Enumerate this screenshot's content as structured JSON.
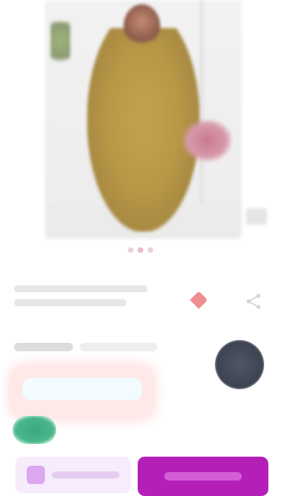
{
  "product": {
    "title": "",
    "price": "",
    "original_price": "",
    "promo_text": "",
    "badge": ""
  },
  "gallery": {
    "dots_total": 3,
    "active_dot": 1
  },
  "icons": {
    "wishlist": "heart-icon",
    "share": "share-icon",
    "cart": "cart-icon"
  },
  "actions": {
    "add_to_cart_label": "",
    "buy_now_label": ""
  },
  "colors": {
    "primary": "#b41fb8",
    "wishlist": "#ef8e8e",
    "promo_bg": "#ffe8e8",
    "badge": "#3aaa7e"
  }
}
